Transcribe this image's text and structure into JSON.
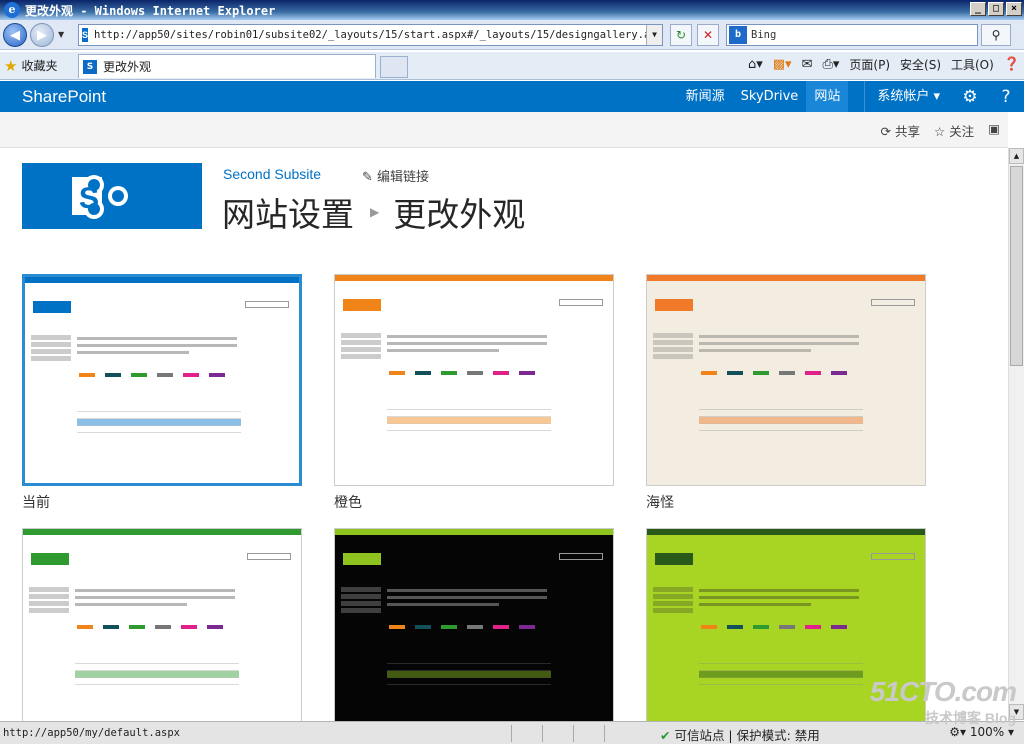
{
  "browser": {
    "title": "更改外观 - Windows Internet Explorer",
    "address": "http://app50/sites/robin01/subsite02/_layouts/15/start.aspx#/_layouts/15/designgallery.aspx",
    "search_value": "Bing",
    "favorites_label": "收藏夹",
    "tab_label": "更改外观",
    "cmd_page": "页面(P)",
    "cmd_safety": "安全(S)",
    "cmd_tools": "工具(O)",
    "window_buttons": [
      "_",
      "□",
      "×"
    ]
  },
  "suite": {
    "brand": "SharePoint",
    "links": [
      "新闻源",
      "SkyDrive",
      "网站"
    ],
    "account": "系统帐户 ▾"
  },
  "ribbon": {
    "share": "共享",
    "follow": "关注"
  },
  "page": {
    "site_name": "Second Subsite",
    "edit_links": "编辑链接",
    "breadcrumb_parent": "网站设置",
    "title": "更改外观"
  },
  "gallery": [
    {
      "caption": "当前",
      "accent": "#0072c6",
      "bg": "#ffffff",
      "text": "#333333",
      "selected": true
    },
    {
      "caption": "橙色",
      "accent": "#f08418",
      "bg": "#ffffff",
      "text": "#333333",
      "selected": false
    },
    {
      "caption": "海怪",
      "accent": "#f07a28",
      "bg": "#f2ede0",
      "text": "#555555",
      "selected": false
    },
    {
      "caption": "",
      "accent": "#2f9a2f",
      "bg": "#ffffff",
      "text": "#333333",
      "selected": false
    },
    {
      "caption": "",
      "accent": "#8fc31f",
      "bg": "#050505",
      "text": "#eeeeee",
      "selected": false
    },
    {
      "caption": "",
      "accent": "#2a5a1a",
      "bg": "#a8d424",
      "text": "#222222",
      "selected": false
    }
  ],
  "status": {
    "url": "http://app50/my/default.aspx",
    "trust": "可信站点 | 保护模式: 禁用",
    "zoom": "100%"
  },
  "watermark": {
    "line1": "51CTO.com",
    "line2": "技术博客 Blog"
  }
}
